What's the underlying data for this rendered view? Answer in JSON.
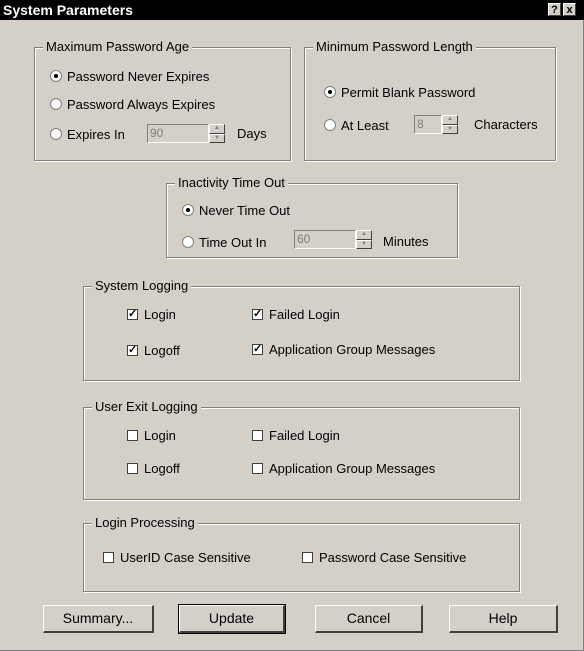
{
  "window": {
    "title": "System Parameters",
    "help_glyph": "?",
    "close_glyph": "x"
  },
  "max_password_age": {
    "legend": "Maximum Password Age",
    "options": [
      "Password Never Expires",
      "Password Always Expires",
      "Expires In"
    ],
    "selected": 0,
    "expires_in_value": "90",
    "unit": "Days"
  },
  "min_password_length": {
    "legend": "Minimum Password Length",
    "options": [
      "Permit Blank Password",
      "At Least"
    ],
    "selected": 0,
    "at_least_value": "8",
    "unit": "Characters"
  },
  "inactivity": {
    "legend": "Inactivity Time Out",
    "options": [
      "Never Time Out",
      "Time Out In"
    ],
    "selected": 0,
    "timeout_value": "60",
    "unit": "Minutes"
  },
  "system_logging": {
    "legend": "System Logging",
    "items": [
      {
        "label": "Login",
        "checked": true
      },
      {
        "label": "Failed Login",
        "checked": true
      },
      {
        "label": "Logoff",
        "checked": true
      },
      {
        "label": "Application Group Messages",
        "checked": true
      }
    ]
  },
  "user_exit_logging": {
    "legend": "User Exit Logging",
    "items": [
      {
        "label": "Login",
        "checked": false
      },
      {
        "label": "Failed Login",
        "checked": false
      },
      {
        "label": "Logoff",
        "checked": false
      },
      {
        "label": "Application Group Messages",
        "checked": false
      }
    ]
  },
  "login_processing": {
    "legend": "Login Processing",
    "items": [
      {
        "label": "UserID Case Sensitive",
        "checked": false
      },
      {
        "label": "Password Case Sensitive",
        "checked": false
      }
    ]
  },
  "buttons": {
    "summary": "Summary...",
    "update": "Update",
    "cancel": "Cancel",
    "help": "Help"
  }
}
